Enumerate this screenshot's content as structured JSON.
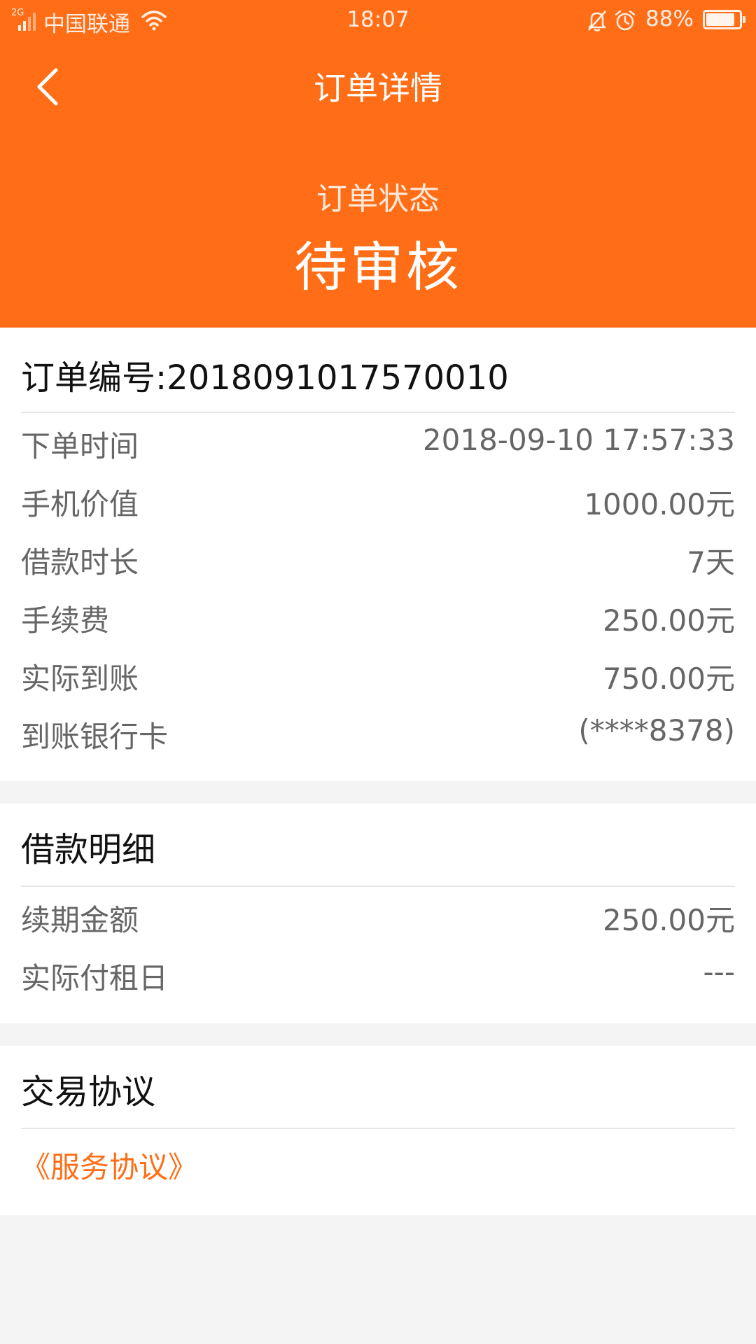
{
  "statusbar": {
    "network": "2G",
    "carrier": "中国联通",
    "time": "18:07",
    "battery": "88%",
    "battery_level": 0.88
  },
  "nav": {
    "title": "订单详情"
  },
  "order_status": {
    "label": "订单状态",
    "value": "待审核"
  },
  "order": {
    "number_text": "订单编号:2018091017570010",
    "rows": [
      {
        "label": "下单时间",
        "value": "2018-09-10 17:57:33"
      },
      {
        "label": "手机价值",
        "value": "1000.00元"
      },
      {
        "label": "借款时长",
        "value": "7天"
      },
      {
        "label": "手续费",
        "value": "250.00元"
      },
      {
        "label": "实际到账",
        "value": "750.00元"
      },
      {
        "label": "到账银行卡",
        "value": "(****8378)"
      }
    ]
  },
  "loan_details": {
    "title": "借款明细",
    "rows": [
      {
        "label": "续期金额",
        "value": "250.00元"
      },
      {
        "label": "实际付租日",
        "value": "---"
      }
    ]
  },
  "agreement": {
    "title": "交易协议",
    "link_label": "《服务协议》"
  },
  "colors": {
    "accent": "#ff6e17",
    "background": "#f4f4f4"
  }
}
